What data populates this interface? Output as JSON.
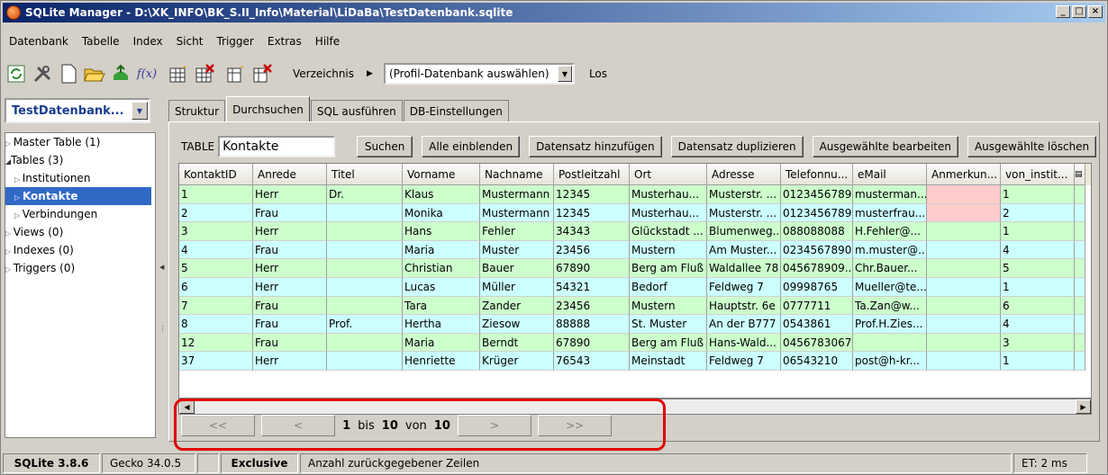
{
  "window": {
    "title": "SQLite Manager - D:\\XK_INFO\\BK_S.II_Info\\Material\\LiDaBa\\TestDatenbank.sqlite",
    "minimize": "_",
    "maximize": "□",
    "close": "×"
  },
  "menu": [
    "Datenbank",
    "Tabelle",
    "Index",
    "Sicht",
    "Trigger",
    "Extras",
    "Hilfe"
  ],
  "toolbar": {
    "function_label": "f(x)",
    "directory_label": "Verzeichnis",
    "profile_select": "(Profil-Datenbank auswählen)",
    "go_label": "Los"
  },
  "db_select": "TestDatenbank...",
  "tree": {
    "master": "Master Table (1)",
    "tables": "Tables (3)",
    "items": [
      "Institutionen",
      "Kontakte",
      "Verbindungen"
    ],
    "views": "Views (0)",
    "indexes": "Indexes (0)",
    "triggers": "Triggers (0)"
  },
  "tabs": [
    "Struktur",
    "Durchsuchen",
    "SQL ausführen",
    "DB-Einstellungen"
  ],
  "browse": {
    "table_label": "TABLE",
    "table_value": "Kontakte",
    "search": "Suchen",
    "show_all": "Alle einblenden",
    "add": "Datensatz hinzufügen",
    "duplicate": "Datensatz duplizieren",
    "edit": "Ausgewählte bearbeiten",
    "delete": "Ausgewählte löschen"
  },
  "columns": [
    "KontaktID",
    "Anrede",
    "Titel",
    "Vorname",
    "Nachname",
    "Postleitzahl",
    "Ort",
    "Adresse",
    "Telefonnu...",
    "eMail",
    "Anmerkun...",
    "von_instit..."
  ],
  "rows": [
    [
      "1",
      "Herr",
      "Dr.",
      "Klaus",
      "Mustermann",
      "12345",
      "Musterhau...",
      "Musterstr. ...",
      "0123456789",
      "musterman...",
      "",
      "1"
    ],
    [
      "2",
      "Frau",
      "",
      "Monika",
      "Mustermann",
      "12345",
      "Musterhau...",
      "Musterstr. ...",
      "0123456789",
      "musterfrau...",
      "",
      "2"
    ],
    [
      "3",
      "Herr",
      "",
      "Hans",
      "Fehler",
      "34343",
      "Glückstadt ...",
      "Blumenweg...",
      "088088088",
      "H.Fehler@...",
      "",
      "1"
    ],
    [
      "4",
      "Frau",
      "",
      "Maria",
      "Muster",
      "23456",
      "Mustern",
      "Am Muster...",
      "0234567890",
      "m.muster@...",
      "",
      "4"
    ],
    [
      "5",
      "Herr",
      "",
      "Christian",
      "Bauer",
      "67890",
      "Berg am Fluß",
      "Waldallee 78",
      "045678909...",
      "Chr.Bauer...",
      "",
      "5"
    ],
    [
      "6",
      "Herr",
      "",
      "Lucas",
      "Müller",
      "54321",
      "Bedorf",
      "Feldweg 7",
      "09998765",
      "Mueller@te...",
      "",
      "1"
    ],
    [
      "7",
      "Frau",
      "",
      "Tara",
      "Zander",
      "23456",
      "Mustern",
      "Hauptstr. 6e",
      "0777711",
      "Ta.Zan@w...",
      "",
      "6"
    ],
    [
      "8",
      "Frau",
      "Prof.",
      "Hertha",
      "Ziesow",
      "88888",
      "St. Muster",
      "An der B777",
      "0543861",
      "Prof.H.Zies...",
      "",
      "4"
    ],
    [
      "12",
      "Frau",
      "",
      "Maria",
      "Berndt",
      "67890",
      "Berg am Fluß",
      "Hans-Wald...",
      "0456783067",
      "",
      "",
      "3"
    ],
    [
      "37",
      "Herr",
      "",
      "Henriette",
      "Krüger",
      "76543",
      "Meinstadt",
      "Feldweg 7",
      "06543210",
      "post@h-kr...",
      "",
      "1"
    ]
  ],
  "nav": {
    "first": "<<",
    "prev": "<",
    "from": "1",
    "bis": "bis",
    "to": "10",
    "von": "von",
    "total": "10",
    "next": ">",
    "last": ">>"
  },
  "status": {
    "sqlite": "SQLite 3.8.6",
    "gecko": "Gecko 34.0.5",
    "mode": "Exclusive",
    "message": "Anzahl zurückgegebener Zeilen",
    "et": "ET: 2 ms"
  },
  "colors": {
    "row_green": "#ccffcc",
    "row_cyan": "#ccffff",
    "null_pink": "#ffcccc",
    "highlight": "#e00000",
    "selected": "#3169c6"
  }
}
